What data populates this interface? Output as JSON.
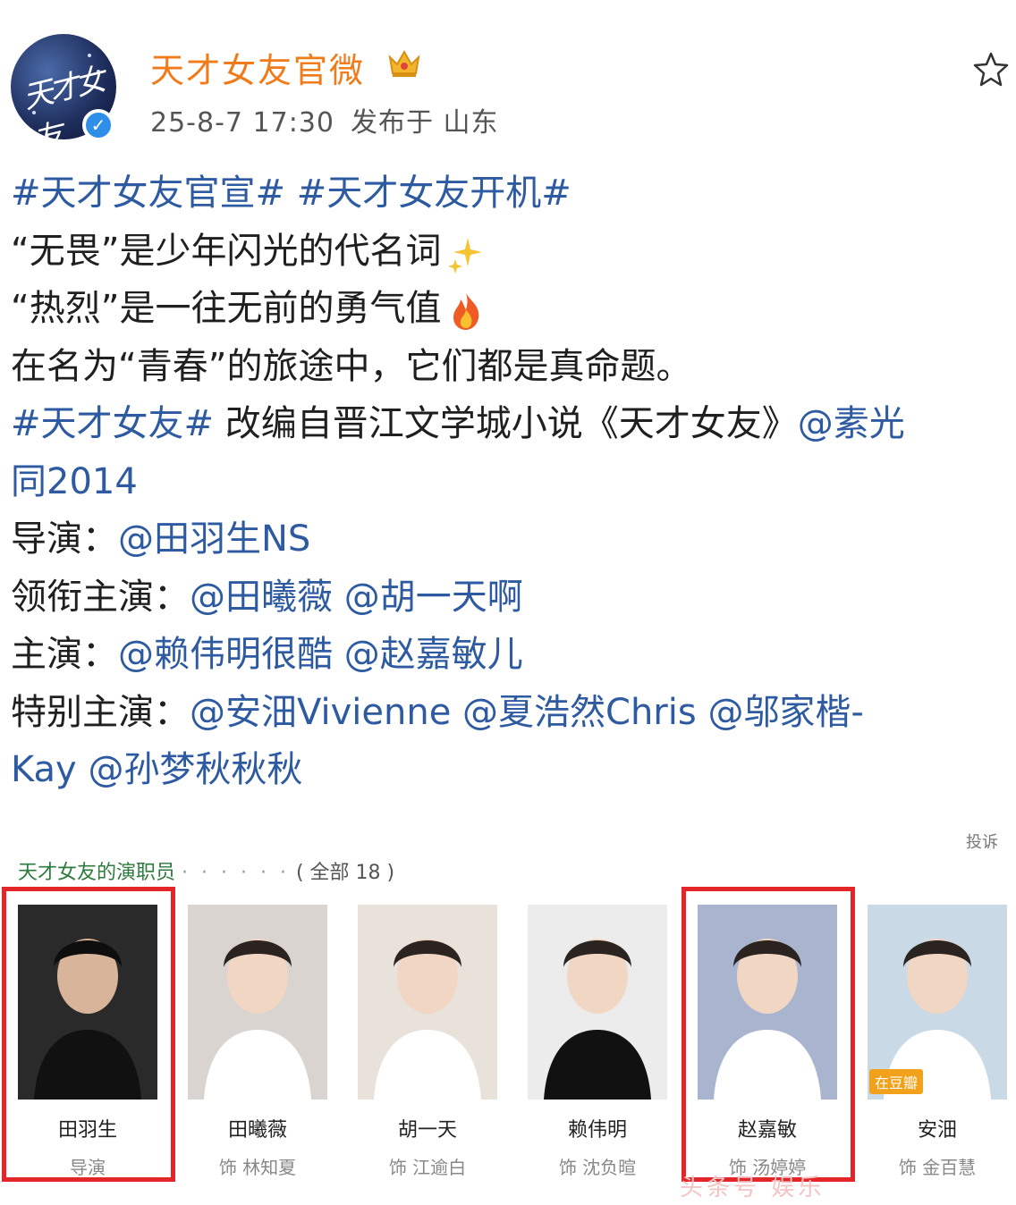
{
  "header": {
    "account_name": "天才女友官微",
    "timestamp": "25-8-7 17:30",
    "location": "发布于 山东",
    "avatar_text": "天才女友"
  },
  "post": {
    "lines": [
      [
        {
          "t": "#天才女友官宣#",
          "link": true
        },
        {
          "t": "  "
        },
        {
          "t": "#天才女友开机#",
          "link": true
        }
      ],
      [
        {
          "t": "“无畏”是少年闪光的代名词"
        },
        {
          "emoji": "sparkles-icon"
        }
      ],
      [
        {
          "t": "“热烈”是一往无前的勇气值"
        },
        {
          "emoji": "fire-icon"
        }
      ],
      [
        {
          "t": "在名为“青春”的旅途中，它们都是真命题。"
        }
      ],
      [
        {
          "t": "#天才女友#",
          "link": true
        },
        {
          "t": " 改编自晋江文学城小说《天才女友》"
        },
        {
          "t": "@素光",
          "link": true
        }
      ],
      [
        {
          "t": "同2014",
          "link": true
        }
      ],
      [
        {
          "t": "导演："
        },
        {
          "t": "@田羽生NS",
          "link": true
        }
      ],
      [
        {
          "t": "领衔主演："
        },
        {
          "t": "@田曦薇",
          "link": true
        },
        {
          "t": " "
        },
        {
          "t": "@胡一天啊",
          "link": true
        }
      ],
      [
        {
          "t": "主演："
        },
        {
          "t": "@赖伟明很酷",
          "link": true
        },
        {
          "t": " "
        },
        {
          "t": "@赵嘉敏儿",
          "link": true
        }
      ],
      [
        {
          "t": "特别主演："
        },
        {
          "t": "@安沺Vivienne",
          "link": true
        },
        {
          "t": " "
        },
        {
          "t": "@夏浩然Chris",
          "link": true
        },
        {
          "t": " "
        },
        {
          "t": "@邬家楷-",
          "link": true
        }
      ],
      [
        {
          "t": "Kay",
          "link": true
        },
        {
          "t": " "
        },
        {
          "t": "@孙梦秋秋秋",
          "link": true
        }
      ]
    ]
  },
  "cast_section": {
    "title": "天才女友的演职员",
    "dots": "· · · · · ·",
    "count_label": "( 全部 18 )",
    "report_label": "投诉",
    "members": [
      {
        "name": "田羽生",
        "role": "导演",
        "highlighted": true,
        "bg": "#2a2a2a"
      },
      {
        "name": "田曦薇",
        "role": "饰 林知夏",
        "highlighted": false,
        "bg": "#d9d4cf"
      },
      {
        "name": "胡一天",
        "role": "饰 江逾白",
        "highlighted": false,
        "bg": "#e8e2da"
      },
      {
        "name": "赖伟明",
        "role": "饰 沈负暄",
        "highlighted": false,
        "bg": "#ececec"
      },
      {
        "name": "赵嘉敏",
        "role": "饰 汤婷婷",
        "highlighted": true,
        "bg": "#a9b5cf"
      },
      {
        "name": "安沺",
        "role": "饰 金百慧",
        "highlighted": false,
        "bg": "#c9d9e6",
        "badge": "在豆瓣"
      }
    ]
  },
  "watermark": "头条号 娱乐"
}
